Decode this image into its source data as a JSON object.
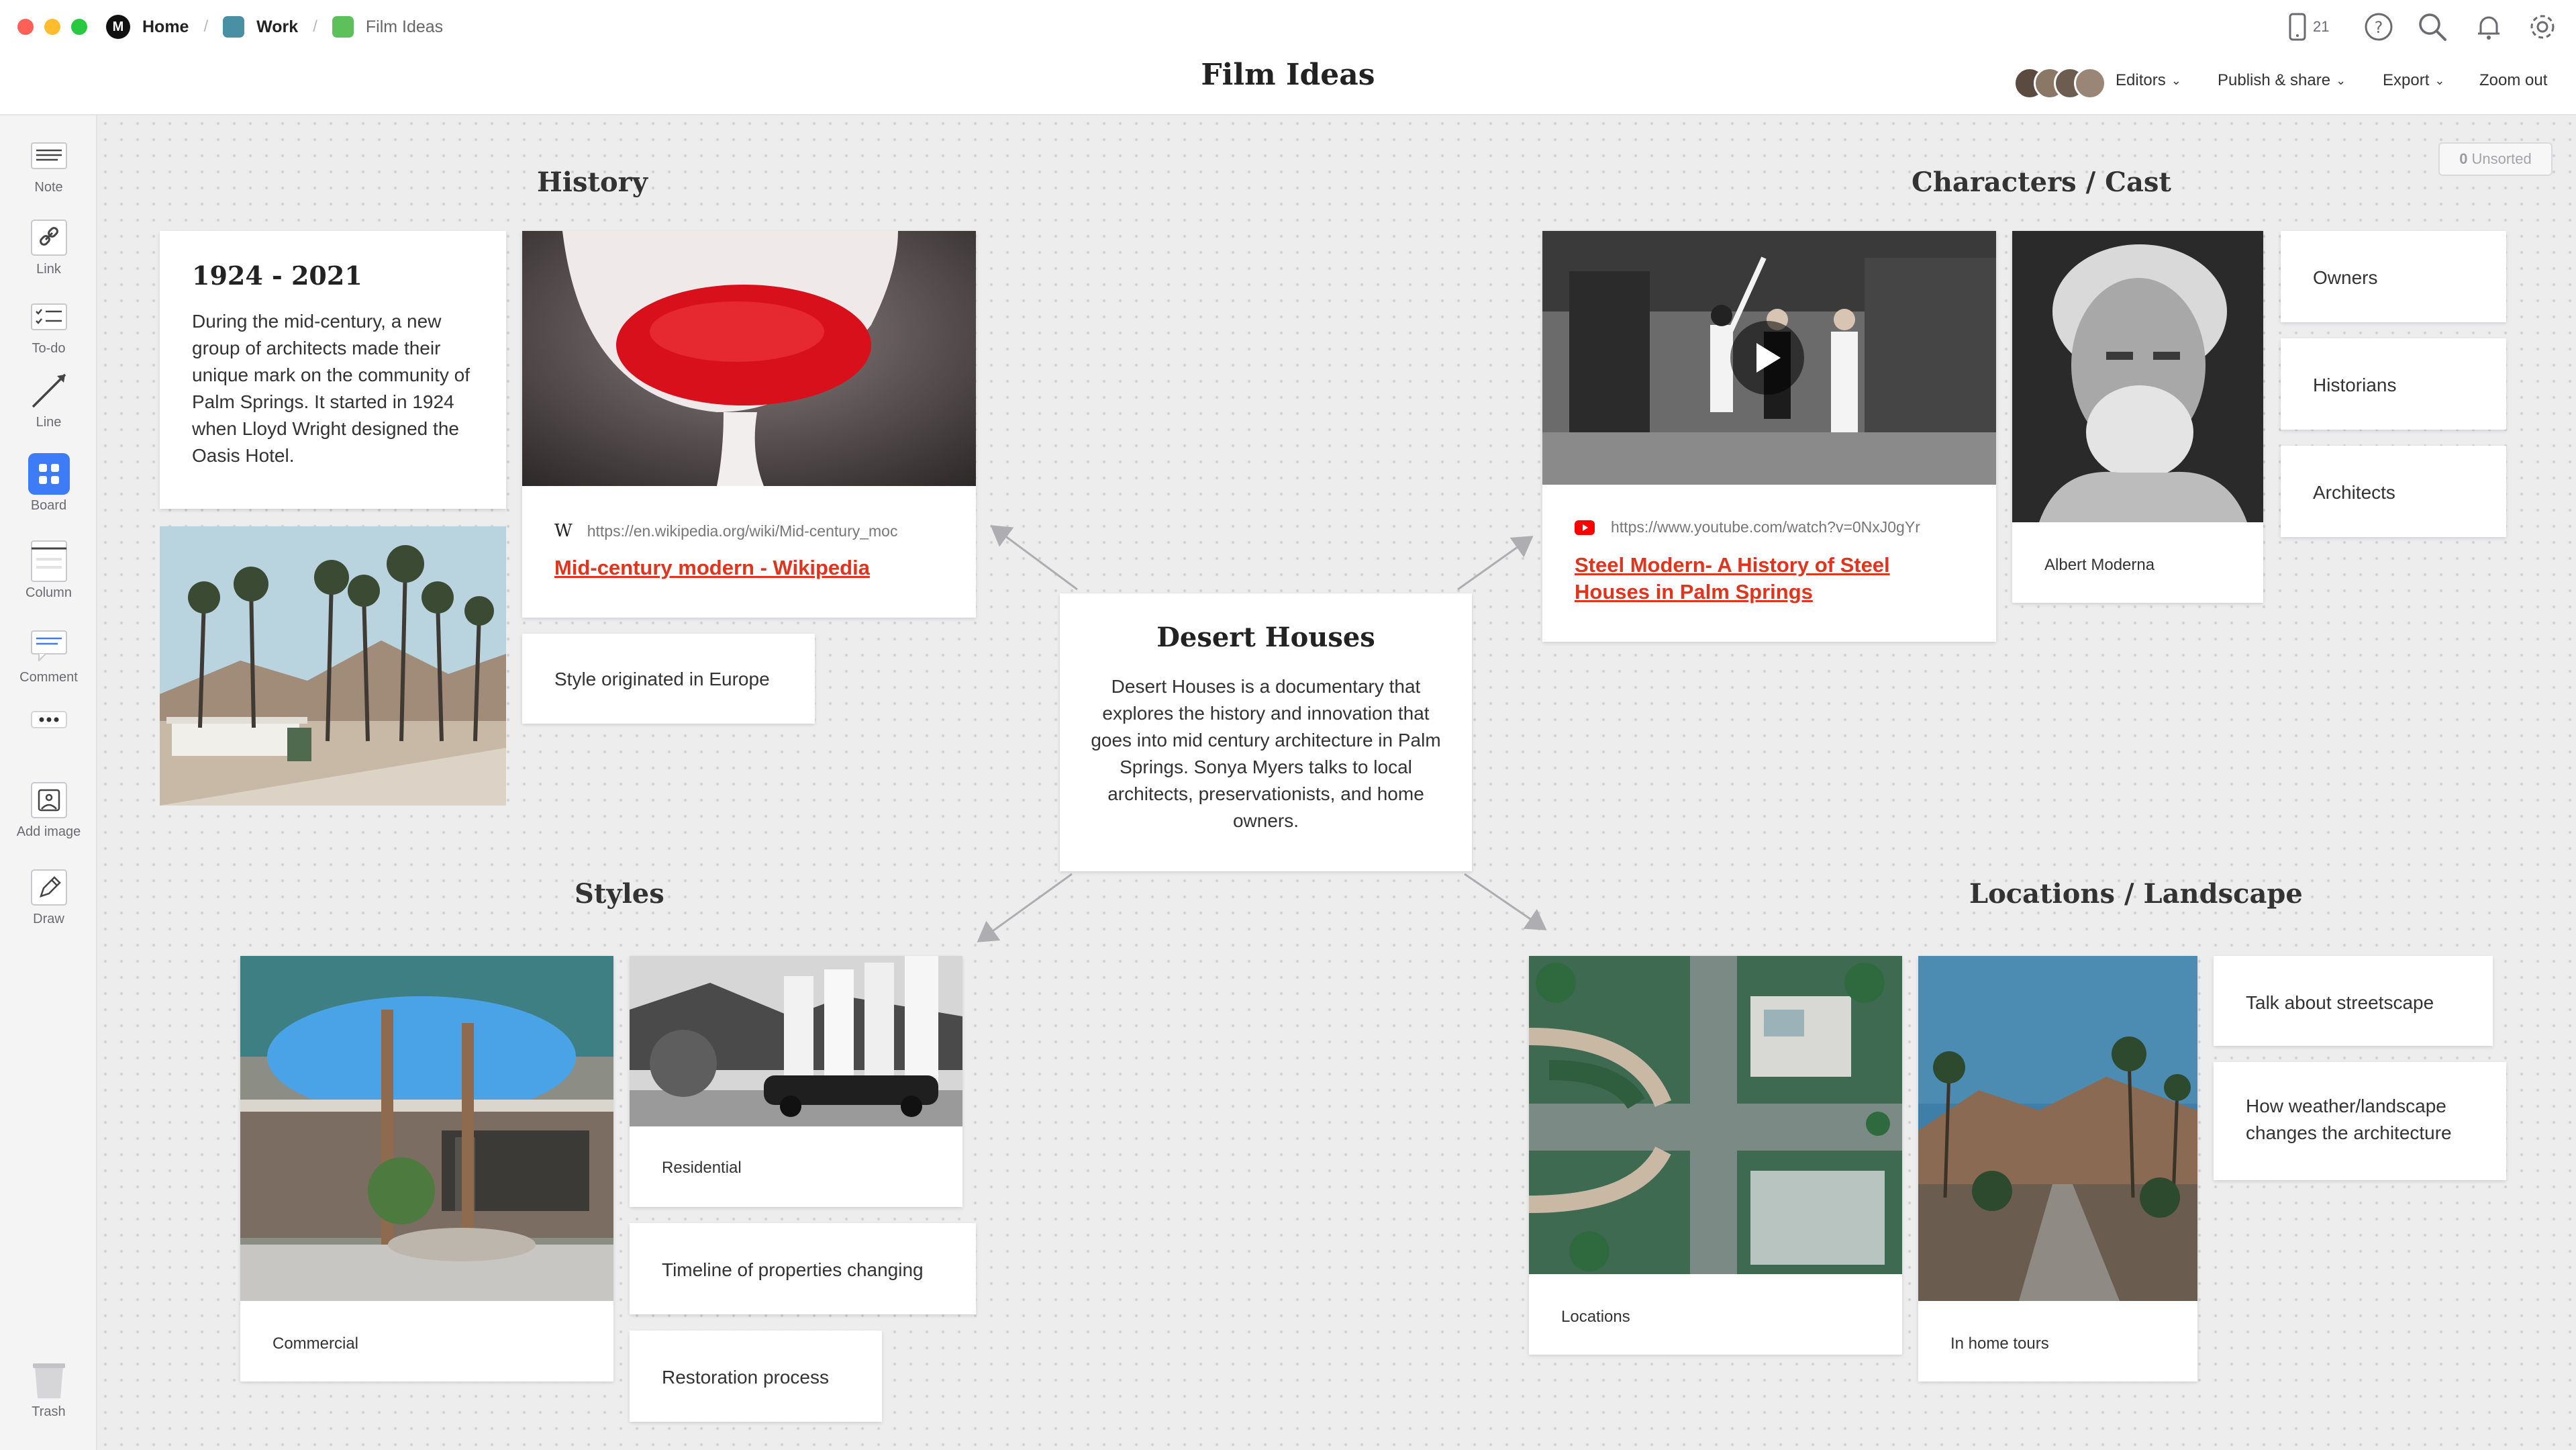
{
  "breadcrumbs": {
    "home": "Home",
    "work": "Work",
    "film_ideas": "Film Ideas",
    "work_color": "#4a90a4",
    "film_color": "#5cc15a"
  },
  "title": "Film Ideas",
  "topbar": {
    "device_count": "21",
    "editors": "Editors",
    "publish": "Publish & share",
    "export": "Export",
    "zoom": "Zoom out"
  },
  "sidebar": {
    "note": "Note",
    "link": "Link",
    "todo": "To-do",
    "line": "Line",
    "board": "Board",
    "column": "Column",
    "comment": "Comment",
    "add_image": "Add image",
    "draw": "Draw",
    "trash": "Trash"
  },
  "unsorted": {
    "count": "0",
    "label": "Unsorted"
  },
  "history": {
    "heading": "History",
    "note_title": "1924 - 2021",
    "note_body": "During the mid-century, a new group of architects made their unique mark on the community of Palm Springs. It started in 1924 when Lloyd Wright designed the Oasis Hotel.",
    "link_url": "https://en.wikipedia.org/wiki/Mid-century_moc",
    "link_title": "Mid-century modern - Wikipedia",
    "style_note": "Style originated in Europe"
  },
  "center": {
    "title": "Desert Houses",
    "body": "Desert Houses is a documentary that explores the history and innovation that goes into mid century architecture in Palm Springs. Sonya Myers talks to local architects, preservationists, and home owners."
  },
  "characters": {
    "heading": "Characters / Cast",
    "link_url": "https://www.youtube.com/watch?v=0NxJ0gYr",
    "link_title": "Steel Modern- A History of Steel Houses in Palm Springs",
    "portrait_caption": "Albert Moderna",
    "notes": [
      "Owners",
      "Historians",
      "Architects"
    ]
  },
  "styles": {
    "heading": "Styles",
    "commercial": "Commercial",
    "residential": "Residential",
    "timeline": "Timeline of properties changing",
    "restoration": "Restoration process"
  },
  "locations": {
    "heading": "Locations / Landscape",
    "locations_caption": "Locations",
    "tours_caption": "In home tours",
    "streetscape": "Talk about streetscape",
    "weather": "How weather/landscape changes the architecture"
  },
  "colors": {
    "accent_red": "#e0341d",
    "board_blue": "#3d7bf7"
  }
}
